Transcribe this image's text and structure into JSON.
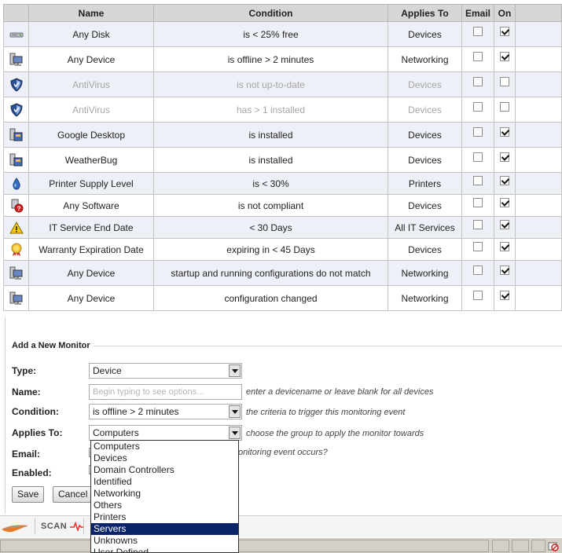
{
  "table": {
    "headers": {
      "icon": "",
      "name": "Name",
      "condition": "Condition",
      "applies_to": "Applies To",
      "email": "Email",
      "on": "On"
    },
    "rows": [
      {
        "icon": "disk-icon",
        "name": "Any Disk",
        "condition": "is < 25% free",
        "applies_to": "Devices",
        "email": false,
        "on": true,
        "disabled": false
      },
      {
        "icon": "device-icon",
        "name": "Any Device",
        "condition": "is offline > 2 minutes",
        "applies_to": "Networking",
        "email": false,
        "on": true,
        "disabled": false
      },
      {
        "icon": "antivirus-shield-icon",
        "name": "AntiVirus",
        "condition": "is not up-to-date",
        "applies_to": "Devices",
        "email": false,
        "on": false,
        "disabled": true
      },
      {
        "icon": "antivirus-shield-icon",
        "name": "AntiVirus",
        "condition": "has > 1 installed",
        "applies_to": "Devices",
        "email": false,
        "on": false,
        "disabled": true
      },
      {
        "icon": "software-package-icon",
        "name": "Google Desktop",
        "condition": "is installed",
        "applies_to": "Devices",
        "email": false,
        "on": true,
        "disabled": false
      },
      {
        "icon": "software-package-icon",
        "name": "WeatherBug",
        "condition": "is installed",
        "applies_to": "Devices",
        "email": false,
        "on": true,
        "disabled": false
      },
      {
        "icon": "ink-drop-icon",
        "name": "Printer Supply Level",
        "condition": "is < 30%",
        "applies_to": "Printers",
        "email": false,
        "on": true,
        "disabled": false
      },
      {
        "icon": "software-compliance-icon",
        "name": "Any Software",
        "condition": "is not compliant",
        "applies_to": "Devices",
        "email": false,
        "on": true,
        "disabled": false
      },
      {
        "icon": "warning-icon",
        "name": "IT Service End Date",
        "condition": "< 30 Days",
        "applies_to": "All IT Services",
        "email": false,
        "on": true,
        "disabled": false
      },
      {
        "icon": "warranty-ribbon-icon",
        "name": "Warranty Expiration Date",
        "condition": "expiring in < 45 Days",
        "applies_to": "Devices",
        "email": false,
        "on": true,
        "disabled": false
      },
      {
        "icon": "device-icon",
        "name": "Any Device",
        "condition": "startup and running configurations do not match",
        "applies_to": "Networking",
        "email": false,
        "on": true,
        "disabled": false
      },
      {
        "icon": "device-icon",
        "name": "Any Device",
        "condition": "configuration changed",
        "applies_to": "Networking",
        "email": false,
        "on": true,
        "disabled": false
      }
    ]
  },
  "form": {
    "legend": "Add a New Monitor",
    "type_label": "Type:",
    "type_value": "Device",
    "name_label": "Name:",
    "name_placeholder": "Begin typing to see options...",
    "name_hint": "enter a devicename or leave blank for all devices",
    "condition_label": "Condition:",
    "condition_value": "is offline > 2 minutes",
    "condition_hint": "the criteria to trigger this monitoring event",
    "applies_label": "Applies To:",
    "applies_value": "Computers",
    "applies_hint": "choose the group to apply the monitor towards",
    "email_label": "Email:",
    "email_hint": "onitoring event occurs?",
    "enabled_label": "Enabled:",
    "save_label": "Save",
    "cancel_label": "Cancel"
  },
  "applies_dropdown": {
    "options": [
      "Computers",
      "Devices",
      "Domain Controllers",
      "Identified",
      "Networking",
      "Others",
      "Printers",
      "Servers",
      "Unknowns",
      "User Defined"
    ],
    "highlighted": "Servers"
  },
  "bottom_bar": {
    "scan_label": "SCAN"
  },
  "colors": {
    "header_bg": "#d6d6d6",
    "row_shaded": "#eef0f8",
    "selection": "#0a246a",
    "status_bar": "#d4d0c8"
  }
}
